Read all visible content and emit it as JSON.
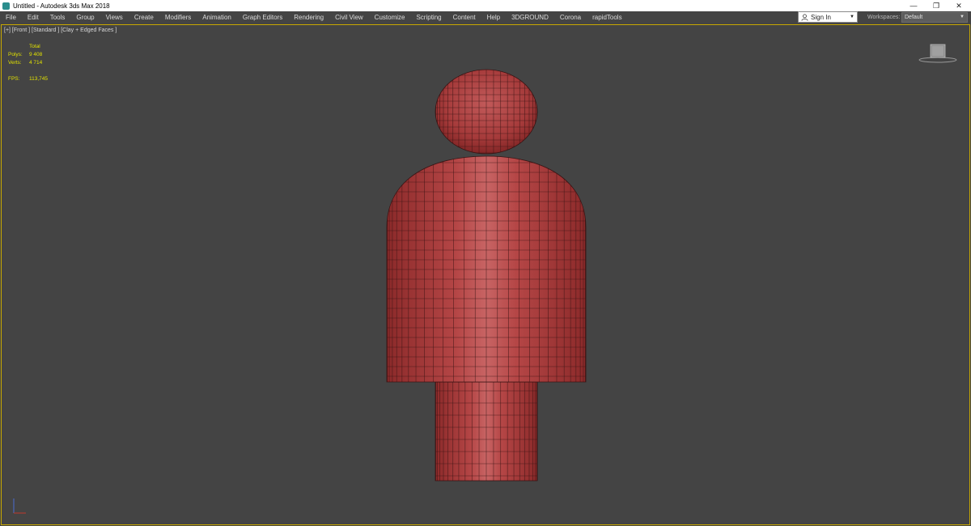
{
  "window": {
    "title": "Untitled - Autodesk 3ds Max 2018",
    "controls": [
      "—",
      "❐",
      "✕"
    ]
  },
  "menu": [
    "File",
    "Edit",
    "Tools",
    "Group",
    "Views",
    "Create",
    "Modifiers",
    "Animation",
    "Graph Editors",
    "Rendering",
    "Civil View",
    "Customize",
    "Scripting",
    "Content",
    "Help",
    "3DGROUND",
    "Corona",
    "rapidTools"
  ],
  "signin": {
    "label": "Sign In"
  },
  "workspaces": {
    "label": "Workspaces:",
    "value": "Default"
  },
  "viewport": {
    "label": "[+] [Front ] [Standard ] [Clay + Edged Faces ]",
    "stats": {
      "header": "Total",
      "polys_label": "Polys:",
      "polys_value": "9 408",
      "verts_label": "Verts:",
      "verts_value": "4 714",
      "fps_label": "FPS:",
      "fps_value": "113,745"
    }
  },
  "colors": {
    "viewport_bg": "#444444",
    "clay": "#b03a3a",
    "wire": "#3a1414",
    "active_border": "#c8a800",
    "stats_text": "#e2e200"
  }
}
